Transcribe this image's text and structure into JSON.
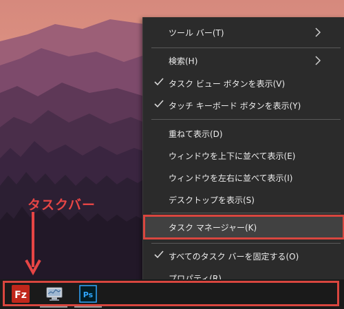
{
  "annotation": {
    "label": "タスクバー"
  },
  "context_menu": {
    "items": [
      {
        "id": "toolbar",
        "label": "ツール バー(T)",
        "checked": false,
        "submenu": true
      },
      {
        "id": "search",
        "label": "検索(H)",
        "checked": false,
        "submenu": true
      },
      {
        "id": "task-view",
        "label": "タスク ビュー ボタンを表示(V)",
        "checked": true,
        "submenu": false
      },
      {
        "id": "touch-keyboard",
        "label": "タッチ キーボード ボタンを表示(Y)",
        "checked": true,
        "submenu": false
      },
      {
        "id": "cascade",
        "label": "重ねて表示(D)",
        "checked": false,
        "submenu": false
      },
      {
        "id": "stack",
        "label": "ウィンドウを上下に並べて表示(E)",
        "checked": false,
        "submenu": false
      },
      {
        "id": "side-by-side",
        "label": "ウィンドウを左右に並べて表示(I)",
        "checked": false,
        "submenu": false
      },
      {
        "id": "show-desktop",
        "label": "デスクトップを表示(S)",
        "checked": false,
        "submenu": false
      },
      {
        "id": "task-manager",
        "label": "タスク マネージャー(K)",
        "checked": false,
        "submenu": false,
        "highlighted": true
      },
      {
        "id": "lock-taskbar",
        "label": "すべてのタスク バーを固定する(O)",
        "checked": true,
        "submenu": false
      },
      {
        "id": "properties",
        "label": "プロパティ(R)",
        "checked": false,
        "submenu": false
      }
    ]
  },
  "taskbar": {
    "apps": [
      {
        "name": "filezilla-icon",
        "text": "Fz"
      },
      {
        "name": "network-monitor-icon",
        "text": ""
      },
      {
        "name": "photoshop-icon",
        "text": "Ps"
      }
    ]
  },
  "colors": {
    "accent": "#d9463f",
    "menu_bg": "#2b2b2b",
    "menu_text": "#ededed",
    "taskbar_bg": "#1a1a1a"
  }
}
